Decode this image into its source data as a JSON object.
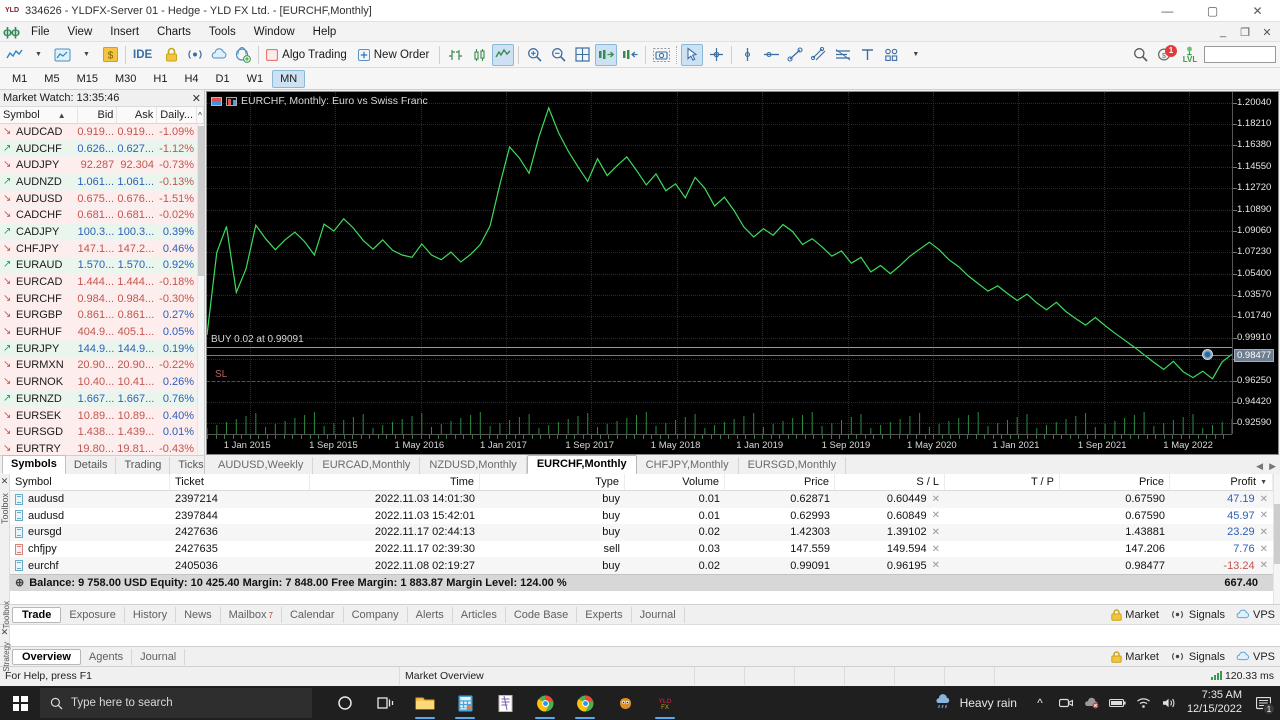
{
  "window": {
    "title": "334626 - YLDFX-Server 01 - Hedge - YLD FX Ltd. - [EURCHF,Monthly]",
    "app_icon": "mt5-icon",
    "minimize": "—",
    "maximize": "▢",
    "close": "✕"
  },
  "menu": {
    "items": [
      "File",
      "View",
      "Insert",
      "Charts",
      "Tools",
      "Window",
      "Help"
    ]
  },
  "toolbar": {
    "algo_trading": "Algo Trading",
    "new_order": "New Order",
    "notification_count": "1",
    "lvl_label": "LVL"
  },
  "timeframes": {
    "items": [
      "M1",
      "M5",
      "M15",
      "M30",
      "H1",
      "H4",
      "D1",
      "W1",
      "MN"
    ],
    "active": "MN"
  },
  "market_watch": {
    "title": "Market Watch: 13:35:46",
    "columns": [
      "Symbol",
      "Bid",
      "Ask",
      "Daily..."
    ],
    "sort_indicator": "▲",
    "tabs": [
      "Symbols",
      "Details",
      "Trading",
      "Ticks"
    ],
    "active_tab": "Symbols",
    "rows": [
      {
        "symbol": "AUDCAD",
        "dir": "down",
        "bid": "0.919...",
        "ask": "0.919...",
        "daily": "-1.09%",
        "trend": "dn"
      },
      {
        "symbol": "AUDCHF",
        "dir": "up",
        "bid": "0.626...",
        "ask": "0.627...",
        "daily": "-1.12%",
        "trend": "up"
      },
      {
        "symbol": "AUDJPY",
        "dir": "down",
        "bid": "92.287",
        "ask": "92.304",
        "daily": "-0.73%",
        "trend": "dn"
      },
      {
        "symbol": "AUDNZD",
        "dir": "up",
        "bid": "1.061...",
        "ask": "1.061...",
        "daily": "-0.13%",
        "trend": "up"
      },
      {
        "symbol": "AUDUSD",
        "dir": "down",
        "bid": "0.675...",
        "ask": "0.676...",
        "daily": "-1.51%",
        "trend": "dn"
      },
      {
        "symbol": "CADCHF",
        "dir": "down",
        "bid": "0.681...",
        "ask": "0.681...",
        "daily": "-0.02%",
        "trend": "dn"
      },
      {
        "symbol": "CADJPY",
        "dir": "up",
        "bid": "100.3...",
        "ask": "100.3...",
        "daily": "0.39%",
        "trend": "up"
      },
      {
        "symbol": "CHFJPY",
        "dir": "down",
        "bid": "147.1...",
        "ask": "147.2...",
        "daily": "0.46%",
        "trend": "dn"
      },
      {
        "symbol": "EURAUD",
        "dir": "up",
        "bid": "1.570...",
        "ask": "1.570...",
        "daily": "0.92%",
        "trend": "up"
      },
      {
        "symbol": "EURCAD",
        "dir": "down",
        "bid": "1.444...",
        "ask": "1.444...",
        "daily": "-0.18%",
        "trend": "dn"
      },
      {
        "symbol": "EURCHF",
        "dir": "down",
        "bid": "0.984...",
        "ask": "0.984...",
        "daily": "-0.30%",
        "trend": "dn"
      },
      {
        "symbol": "EURGBP",
        "dir": "down",
        "bid": "0.861...",
        "ask": "0.861...",
        "daily": "0.27%",
        "trend": "dn"
      },
      {
        "symbol": "EURHUF",
        "dir": "down",
        "bid": "404.9...",
        "ask": "405.1...",
        "daily": "0.05%",
        "trend": "dn"
      },
      {
        "symbol": "EURJPY",
        "dir": "up",
        "bid": "144.9...",
        "ask": "144.9...",
        "daily": "0.19%",
        "trend": "up"
      },
      {
        "symbol": "EURMXN",
        "dir": "down",
        "bid": "20.90...",
        "ask": "20.90...",
        "daily": "-0.22%",
        "trend": "dn"
      },
      {
        "symbol": "EURNOK",
        "dir": "down",
        "bid": "10.40...",
        "ask": "10.41...",
        "daily": "0.26%",
        "trend": "dn"
      },
      {
        "symbol": "EURNZD",
        "dir": "up",
        "bid": "1.667...",
        "ask": "1.667...",
        "daily": "0.76%",
        "trend": "up"
      },
      {
        "symbol": "EURSEK",
        "dir": "down",
        "bid": "10.89...",
        "ask": "10.89...",
        "daily": "0.40%",
        "trend": "dn"
      },
      {
        "symbol": "EURSGD",
        "dir": "down",
        "bid": "1.438...",
        "ask": "1.439...",
        "daily": "0.01%",
        "trend": "dn"
      },
      {
        "symbol": "EURTRY",
        "dir": "down",
        "bid": "19.80...",
        "ask": "19.81...",
        "daily": "-0.43%",
        "trend": "dn"
      }
    ]
  },
  "chart": {
    "title": "EURCHF, Monthly:  Euro vs Swiss Franc",
    "buy_label": "BUY 0.02 at 0.99091",
    "sl_label": "SL",
    "current_price": "0.98477",
    "tabs": [
      "AUDUSD,Weekly",
      "EURCAD,Monthly",
      "NZDUSD,Monthly",
      "EURCHF,Monthly",
      "CHFJPY,Monthly",
      "EURSGD,Monthly"
    ],
    "active_tab": "EURCHF,Monthly"
  },
  "chart_data": {
    "type": "line",
    "title": "EURCHF, Monthly:  Euro vs Swiss Franc",
    "xlabel": "",
    "ylabel": "",
    "ylim": [
      0.9167,
      1.2096
    ],
    "grid": true,
    "legend": "none",
    "y_ticks": [
      "1.20040",
      "1.18210",
      "1.16380",
      "1.14550",
      "1.12720",
      "1.10890",
      "1.09060",
      "1.07230",
      "1.05400",
      "1.03570",
      "1.01740",
      "0.99910",
      "0.98080",
      "0.96250",
      "0.94420",
      "0.92590"
    ],
    "x_ticks": [
      "1 Jan 2015",
      "1 Sep 2015",
      "1 May 2016",
      "1 Jan 2017",
      "1 Sep 2017",
      "1 May 2018",
      "1 Jan 2019",
      "1 Sep 2019",
      "1 May 2020",
      "1 Jan 2021",
      "1 Sep 2021",
      "1 May 2022"
    ],
    "annotations": [
      {
        "label": "BUY 0.02 at 0.99091",
        "value": 0.99091,
        "type": "hline"
      },
      {
        "label": "SL",
        "value": 0.96195,
        "type": "hline"
      },
      {
        "label": "0.98477",
        "value": 0.98477,
        "type": "current-price"
      }
    ],
    "values": [
      1.0015,
      1.0722,
      1.0945,
      1.038,
      1.058,
      1.0955,
      1.084,
      1.0745,
      1.083,
      1.0895,
      1.0815,
      1.07,
      1.0965,
      1.0905,
      1.101,
      1.093,
      1.0825,
      1.075,
      1.083,
      1.074,
      1.07,
      1.068,
      1.0795,
      1.07,
      1.066,
      1.0725,
      1.064,
      1.0705,
      1.079,
      1.095,
      1.1305,
      1.1625,
      1.153,
      1.14,
      1.171,
      1.196,
      1.175,
      1.159,
      1.1455,
      1.133,
      1.1525,
      1.138,
      1.1465,
      1.154,
      1.1425,
      1.13,
      1.1395,
      1.125,
      1.131,
      1.119,
      1.1365,
      1.127,
      1.112,
      1.1195,
      1.108,
      1.094,
      1.0855,
      1.0925,
      1.087,
      1.096,
      1.09,
      1.079,
      1.084,
      1.077,
      1.069,
      1.0735,
      1.063,
      1.068,
      1.0555,
      1.061,
      1.054,
      1.061,
      1.069,
      1.075,
      1.081,
      1.0745,
      1.066,
      1.06,
      1.052,
      1.0455,
      1.039,
      1.0435,
      1.037,
      1.031,
      1.0365,
      1.029,
      1.023,
      1.0295,
      1.0215,
      1.0155,
      1.01,
      1.0165,
      1.0095,
      1.003,
      0.997,
      0.991,
      0.9845,
      0.978,
      0.972,
      0.979,
      0.97,
      0.965,
      0.9705,
      0.964,
      0.9785,
      0.985
    ]
  },
  "trade_table": {
    "columns": [
      "Symbol",
      "Ticket",
      "Time",
      "Type",
      "Volume",
      "Price",
      "S / L",
      "T / P",
      "Price",
      "Profit"
    ],
    "sort_column": "Profit",
    "rows": [
      {
        "symbol": "audusd",
        "ticket": "2397214",
        "time": "2022.11.03 14:01:30",
        "type": "buy",
        "volume": "0.01",
        "price": "0.62871",
        "sl": "0.60449",
        "tp": "",
        "price2": "0.67590",
        "profit": "47.19",
        "sign": "pos"
      },
      {
        "symbol": "audusd",
        "ticket": "2397844",
        "time": "2022.11.03 15:42:01",
        "type": "buy",
        "volume": "0.01",
        "price": "0.62993",
        "sl": "0.60849",
        "tp": "",
        "price2": "0.67590",
        "profit": "45.97",
        "sign": "pos"
      },
      {
        "symbol": "eursgd",
        "ticket": "2427636",
        "time": "2022.11.17 02:44:13",
        "type": "buy",
        "volume": "0.02",
        "price": "1.42303",
        "sl": "1.39102",
        "tp": "",
        "price2": "1.43881",
        "profit": "23.29",
        "sign": "pos"
      },
      {
        "symbol": "chfjpy",
        "ticket": "2427635",
        "time": "2022.11.17 02:39:30",
        "type": "sell",
        "volume": "0.03",
        "price": "147.559",
        "sl": "149.594",
        "tp": "",
        "price2": "147.206",
        "profit": "7.76",
        "sign": "pos"
      },
      {
        "symbol": "eurchf",
        "ticket": "2405036",
        "time": "2022.11.08 02:19:27",
        "type": "buy",
        "volume": "0.02",
        "price": "0.99091",
        "sl": "0.96195",
        "tp": "",
        "price2": "0.98477",
        "profit": "-13.24",
        "sign": "neg"
      }
    ],
    "summary": "Balance: 9 758.00 USD  Equity: 10 425.40  Margin: 7 848.00  Free Margin: 1 883.87  Margin Level: 124.00 %",
    "total_profit": "667.40"
  },
  "toolbox": {
    "side_label": "Toolbox",
    "tabs": [
      "Trade",
      "Exposure",
      "History",
      "News",
      "Mailbox",
      "Calendar",
      "Company",
      "Alerts",
      "Articles",
      "Code Base",
      "Experts",
      "Journal"
    ],
    "active_tab": "Trade",
    "mailbox_badge": "7",
    "right_links": [
      "Market",
      "Signals",
      "VPS"
    ]
  },
  "strategy_tester": {
    "side_label": "Strategy",
    "tabs": [
      "Overview",
      "Agents",
      "Journal"
    ],
    "active_tab": "Overview",
    "right_links": [
      "Market",
      "Signals",
      "VPS"
    ]
  },
  "status_bar": {
    "help": "For Help, press F1",
    "market_overview": "Market Overview",
    "ping": "120.33 ms"
  },
  "taskbar": {
    "search_placeholder": "Type here to search",
    "weather": "Heavy rain",
    "time": "7:35 AM",
    "date": "12/15/2022",
    "notification_count": "1"
  }
}
